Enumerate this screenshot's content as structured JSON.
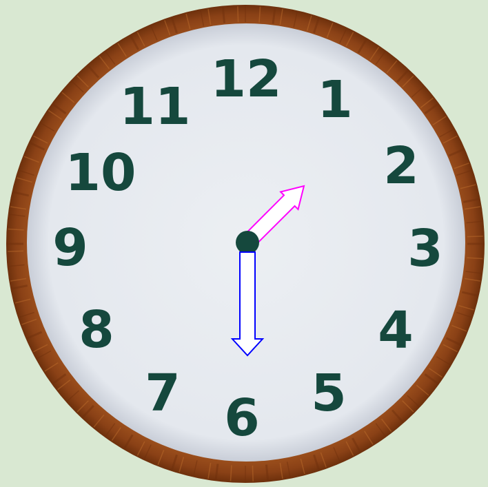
{
  "clock": {
    "numerals": [
      "12",
      "1",
      "2",
      "3",
      "4",
      "5",
      "6",
      "7",
      "8",
      "9",
      "10",
      "11"
    ],
    "hour_hand_points_to": 1.5,
    "minute_hand_points_to": 30,
    "colors": {
      "background": "#d9e8d2",
      "rim": "#8f4618",
      "face": "#e6e9ee",
      "numerals": "#15483d",
      "center_dot": "#15483d",
      "hour_hand_stroke": "#ff00ff",
      "minute_hand_stroke": "#0000ff",
      "hand_fill": "#ffffff"
    }
  }
}
